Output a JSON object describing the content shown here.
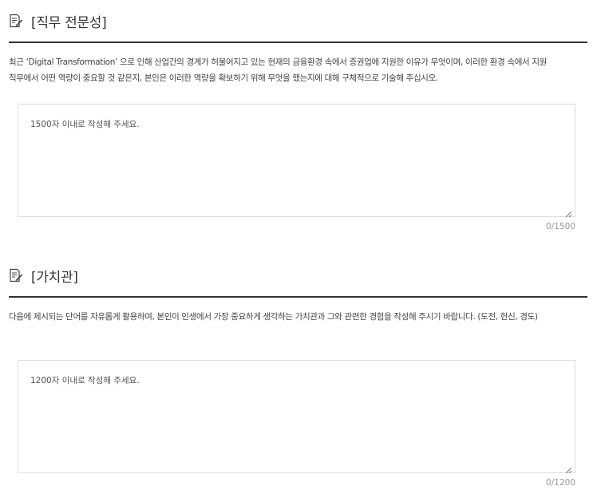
{
  "sections": [
    {
      "icon": "edit-document-icon",
      "title": "[직무 전문성]",
      "question": "최근 ‘Digital Transformation’ 으로 인해 산업간의 경계가 허물어지고 있는 현재의 금융환경 속에서 증권업에 지원한 이유가 무엇이며, 이러한 환경 속에서 지원 직무에서 어떤 역량이 중요할 것 같은지, 본인은 이러한 역량을 확보하기 위해 무엇을 했는지에 대해 구체적으로 기술해 주십시오.",
      "answer_value": "",
      "answer_placeholder": "1500자 이내로 작성해 주세요.",
      "counter": "0/1500"
    },
    {
      "icon": "edit-document-icon",
      "title": "[가치관]",
      "question": "다음에 제시되는 단어를 자유롭게 활용하여, 본인이 인생에서 가장 중요하게 생각하는 가치관과 그와 관련한 경험을 작성해 주시기 바랍니다. (도전, 헌신, 경도)",
      "answer_value": "",
      "answer_placeholder": "1200자 이내로 작성해 주세요.",
      "counter": "0/1200"
    }
  ]
}
